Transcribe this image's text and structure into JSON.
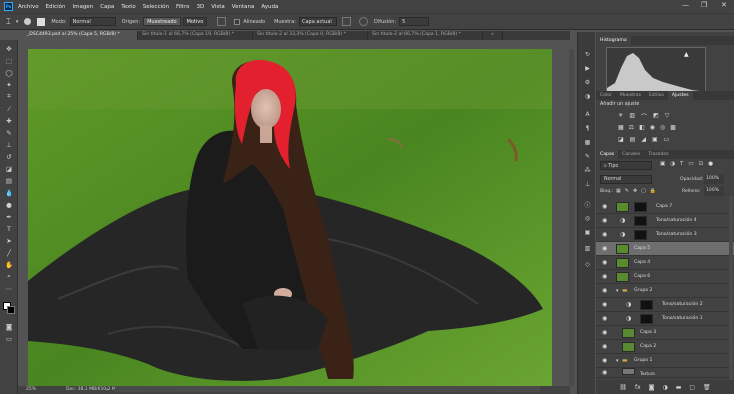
{
  "menu": {
    "logo": "Ps",
    "items": [
      "Archivo",
      "Edición",
      "Imagen",
      "Capa",
      "Texto",
      "Selección",
      "Filtro",
      "3D",
      "Vista",
      "Ventana",
      "Ayuda"
    ]
  },
  "window_controls": {
    "minimize": "—",
    "restore": "❐",
    "close": "✕"
  },
  "options": {
    "mode_label": "Modo:",
    "mode_value": "Normal",
    "origin_label": "Origen:",
    "sampled_button": "Muestreado",
    "pattern_button": "Motivo",
    "aligned_label": "Alineado",
    "sample_label": "Muestra:",
    "sample_value": "Capa actual",
    "diffusion_label": "Difusión:",
    "diffusion_value": "5"
  },
  "tabs": [
    {
      "label": "_DSC4493.psd al 25% (Capa 5, RGB/8) *"
    },
    {
      "label": "Sin título-1 al 66,7% (Capa 19, RGB/8) *"
    },
    {
      "label": "Sin título-2 al 33,3% (Capa 0, RGB/8) *"
    },
    {
      "label": "Sin título-2 al 66,7% (Capa 1, RGB/8) *"
    }
  ],
  "tab_overflow": "»",
  "status": {
    "zoom": "25%",
    "doc": "Doc: 38,1 MB/610,2 MB",
    "arrow": "›"
  },
  "histogram": {
    "tab": "Histograma",
    "warning": "▲"
  },
  "adjust": {
    "tabs": [
      "Color",
      "Muestras",
      "Estilos",
      "Ajustes"
    ],
    "title": "Añadir un ajuste"
  },
  "layers_panel": {
    "tabs": [
      "Capas",
      "Canales",
      "Trazados"
    ],
    "filter": "Tipo",
    "blend": "Normal",
    "opacity_label": "Opacidad:",
    "opacity_value": "100%",
    "lock_label": "Bloq.:",
    "fill_label": "Relleno:",
    "fill_value": "100%",
    "layers": [
      {
        "name": "Capa 7"
      },
      {
        "name": "Tono/saturación 4"
      },
      {
        "name": "Tono/saturación 3"
      },
      {
        "name": "Capa 5"
      },
      {
        "name": "Capa 4"
      },
      {
        "name": "Capa 6"
      },
      {
        "name": "Grupo 2"
      },
      {
        "name": "Tono/saturación 2"
      },
      {
        "name": "Tono/saturación 1"
      },
      {
        "name": "Capa 3"
      },
      {
        "name": "Capa 2"
      },
      {
        "name": "Grupo 1"
      },
      {
        "name": "Textura"
      }
    ],
    "footer_fx": "fx"
  },
  "colors": {
    "accent": "#31a8ff",
    "panel_bg": "#424242",
    "workspace": "#535353",
    "selected_row": "#6e6e6e"
  }
}
